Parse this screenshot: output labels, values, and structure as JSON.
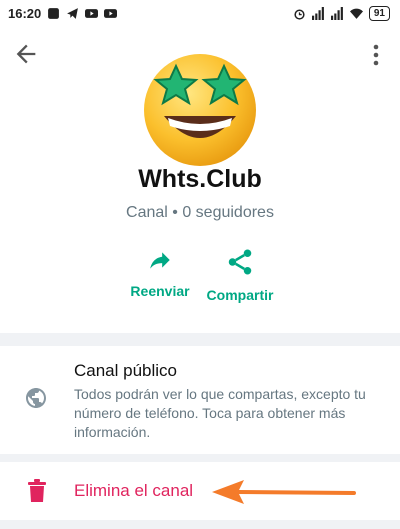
{
  "status_bar": {
    "time": "16:20",
    "battery": "91"
  },
  "icons": {
    "back": "arrow-left-icon",
    "more": "more-vertical-icon",
    "forward": "forward-icon",
    "share": "share-icon",
    "globe": "globe-icon",
    "delete": "trash-icon"
  },
  "channel": {
    "name": "Whts.Club",
    "subtitle": "Canal • 0 seguidores"
  },
  "actions": [
    {
      "label": "Reenviar",
      "icon": "forward-icon"
    },
    {
      "label": "Compartir",
      "icon": "share-icon"
    }
  ],
  "public_section": {
    "title": "Canal público",
    "description": "Todos podrán ver lo que compartas, excepto tu número de teléfono. Toca para obtener más información."
  },
  "delete_label": "Elimina el canal",
  "colors": {
    "accent": "#00a884",
    "danger": "#e0245e",
    "secondary_text": "#667781",
    "annotation_arrow": "#f47b2a",
    "section_background": "#f0f2f5"
  }
}
